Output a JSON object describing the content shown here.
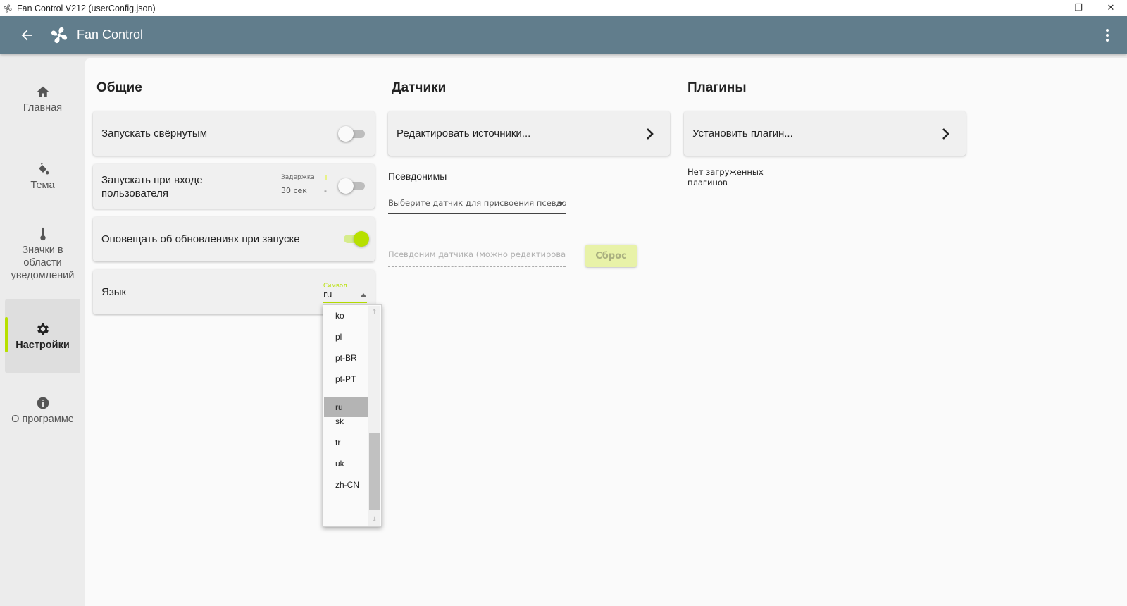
{
  "window": {
    "title": "Fan Control V212 (userConfig.json)",
    "minimize_glyph": "—",
    "maximize_glyph": "❐",
    "close_glyph": "✕"
  },
  "appbar": {
    "title": "Fan Control",
    "back_icon": "arrow-left-icon",
    "logo_icon": "fan-icon",
    "menu_icon": "more-vertical-icon"
  },
  "colors": {
    "appbar": "#617d8c",
    "accent": "#b7e000",
    "sidebar_bg": "#ececec",
    "content_bg": "#fafafa",
    "card_bg": "#f0f0f0"
  },
  "sidebar": {
    "items": [
      {
        "label": "Главная",
        "icon": "home-icon",
        "active": false
      },
      {
        "label": "Тема",
        "icon": "paint-bucket-icon",
        "active": false
      },
      {
        "label": "Значки в области уведомлений",
        "icon": "thermometer-icon",
        "active": false
      },
      {
        "label": "Настройки",
        "icon": "gear-icon",
        "active": true
      },
      {
        "label": "О программе",
        "icon": "info-icon",
        "active": false
      }
    ]
  },
  "general": {
    "title": "Общие",
    "start_minimized": {
      "label": "Запускать свёрнутым",
      "enabled": false
    },
    "start_with_login": {
      "label_line1": "Запускать при входе",
      "label_line2": "пользователя",
      "enabled": false,
      "delay_caption": "Задержка",
      "delay_value": "30 сек",
      "delay_dash": "-"
    },
    "check_updates": {
      "label": "Оповещать об обновлениях при запуске",
      "enabled": true
    },
    "language": {
      "label": "Язык",
      "caption": "Символ",
      "value": "ru",
      "options": [
        "ko",
        "pl",
        "pt-BR",
        "pt-PT",
        "ru",
        "sk",
        "tr",
        "uk",
        "zh-CN"
      ],
      "selected": "ru",
      "scroll_up_glyph": "↑",
      "scroll_down_glyph": "↓"
    }
  },
  "sensors": {
    "title": "Датчики",
    "edit_sources_label": "Редактировать источники...",
    "aliases_label": "Псевдонимы",
    "sensor_select_placeholder": "Выберите датчик для присвоения псевдо",
    "alias_input_placeholder": "Псевдоним датчика (можно редактировать)",
    "reset_label": "Сброс"
  },
  "plugins": {
    "title": "Плагины",
    "install_label": "Установить плагин...",
    "empty_line1": "Нет загруженных",
    "empty_line2": "плагинов"
  }
}
